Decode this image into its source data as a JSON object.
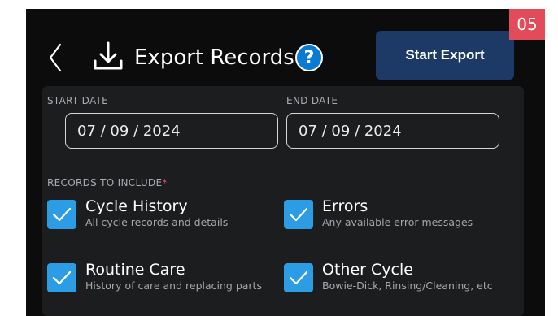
{
  "badge": "05",
  "header": {
    "title": "Export Records",
    "help_glyph": "?",
    "start_label": "Start Export"
  },
  "form": {
    "start_date_label": "START DATE",
    "start_date_value": "07 / 09 / 2024",
    "end_date_label": "END DATE",
    "end_date_value": "07 / 09 / 2024",
    "records_label": "RECORDS TO INCLUDE",
    "required_mark": "*",
    "options": [
      {
        "title": "Cycle History",
        "subtitle": "All cycle records and details",
        "checked": true
      },
      {
        "title": "Errors",
        "subtitle": "Any available error messages",
        "checked": true
      },
      {
        "title": "Routine Care",
        "subtitle": "History of care and replacing parts",
        "checked": true
      },
      {
        "title": "Other Cycle",
        "subtitle": "Bowie-Dick, Rinsing/Cleaning, etc",
        "checked": true
      }
    ]
  },
  "colors": {
    "background": "#0c0c0c",
    "panel": "#1b1d1f",
    "accent_checkbox": "#2c9de4",
    "button": "#1d3a67",
    "badge": "#e14b5a",
    "help": "#0a7bd2"
  },
  "icons": [
    "back-chevron-icon",
    "download-icon",
    "help-icon",
    "checkmark-icon"
  ]
}
